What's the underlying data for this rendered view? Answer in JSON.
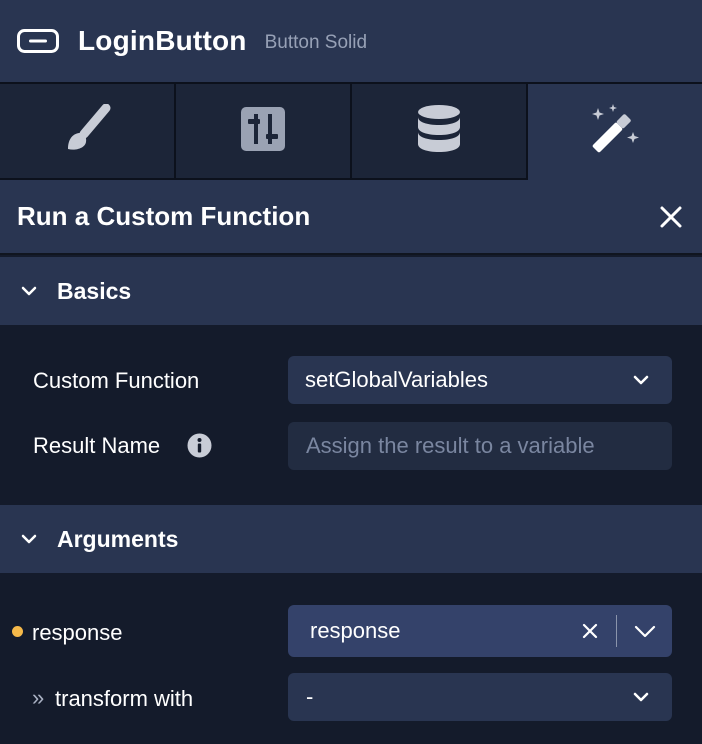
{
  "header": {
    "title": "LoginButton",
    "subtitle": "Button Solid",
    "icon": "button-icon"
  },
  "tabs": [
    {
      "icon": "paintbrush-icon",
      "active": false
    },
    {
      "icon": "sliders-icon",
      "active": false
    },
    {
      "icon": "database-icon",
      "active": false
    },
    {
      "icon": "magic-wand-icon",
      "active": true
    }
  ],
  "panel": {
    "title": "Run a Custom Function",
    "close_icon": "close-icon"
  },
  "basics": {
    "label": "Basics",
    "custom_function": {
      "label": "Custom Function",
      "value": "setGlobalVariables"
    },
    "result_name": {
      "label": "Result Name",
      "placeholder": "Assign the result to a variable"
    }
  },
  "arguments": {
    "label": "Arguments",
    "response": {
      "label": "response",
      "value": "response",
      "dot_color": "#f5b94a"
    },
    "transform": {
      "prefix": "»",
      "label": "transform with",
      "value": "-"
    }
  },
  "colors": {
    "background": "#141b2b",
    "panel": "#293551",
    "accent_dot": "#f5b94a"
  }
}
